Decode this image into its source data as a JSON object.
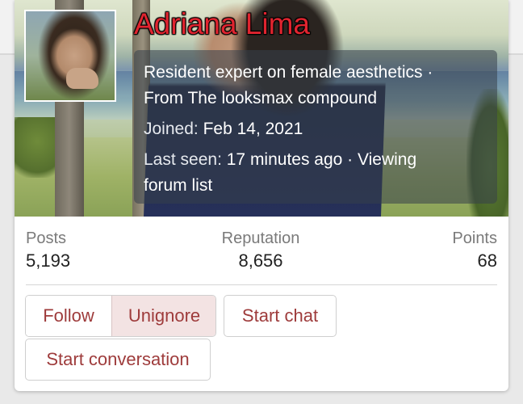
{
  "profile": {
    "name": "Adriana Lima",
    "bio_line_1": "Resident expert on female aesthetics ·",
    "bio_line_2": "From The looksmax compound",
    "joined_label": "Joined:",
    "joined_value": "Feb 14, 2021",
    "last_seen_label": "Last seen:",
    "last_seen_value": "17 minutes ago · Viewing",
    "last_seen_value_2": "forum list"
  },
  "stats": {
    "posts_label": "Posts",
    "posts_value": "5,193",
    "reputation_label": "Reputation",
    "reputation_value": "8,656",
    "points_label": "Points",
    "points_value": "68"
  },
  "actions": {
    "follow": "Follow",
    "unignore": "Unignore",
    "start_chat": "Start chat",
    "start_conversation": "Start conversation"
  },
  "colors": {
    "name": "#e0242f",
    "button_text": "#9e3b3b",
    "active_button_bg": "#f3e3e3"
  }
}
